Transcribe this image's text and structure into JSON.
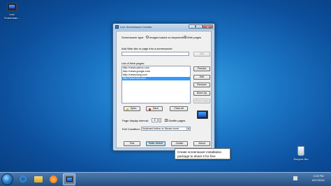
{
  "desktop": {
    "icons": [
      {
        "label_line1": "Live",
        "label_line2": "Screensav...",
        "icon": "screensaver-app-icon"
      },
      {
        "label_line1": "Recycle Bin",
        "icon": "recycle-bin-icon"
      }
    ]
  },
  "window": {
    "title": "Live Screensaver Creator",
    "minimize_glyph": "–",
    "maximize_glyph": "□",
    "close_glyph": "✕",
    "screensaver_type_label": "Screensaver type:",
    "radio_images_label": "Images based on keywords",
    "radio_web_label": "Web pages",
    "add_label": "Add Web site or page into a screensaver:",
    "add_input_value": "",
    "add_button": "Add",
    "list_label": "List of Web pages:",
    "urls": [
      "http://news.yahoo.com",
      "http://news.google.com",
      "http://news.bing.com",
      "http://www.cbc.com"
    ],
    "selected_index": 3,
    "preview_button": "Preview",
    "edit_button": "Edit",
    "remove_button": "Remove",
    "move_up_button": "Move Up",
    "move_down_button": "Move Down",
    "open_button": "Open",
    "save_button": "Save",
    "clear_all_button": "Clear all",
    "page_interval_label": "Page display interval:",
    "page_interval_value": "8",
    "shuffle_label": "Shuffle pages",
    "exit_condition_label": "Exit Condition:",
    "exit_condition_value": "Keyboard button or Mouse move",
    "test_button": "Test",
    "make_default_button": "Make default",
    "create_button": "Create",
    "about_button": "About"
  },
  "tooltip": {
    "line1": "Create screensaver installation",
    "line2": "package to share it for free"
  },
  "taskbar": {
    "time": "3:15 PM",
    "date": "6/17/2012",
    "pinned": [
      "ie-icon",
      "explorer-folder-icon",
      "media-player-icon",
      "live-screensaver-icon"
    ]
  },
  "colors": {
    "desktop_bg": "#1c78c8",
    "selection": "#3399ff",
    "taskbar": "#244f80"
  }
}
